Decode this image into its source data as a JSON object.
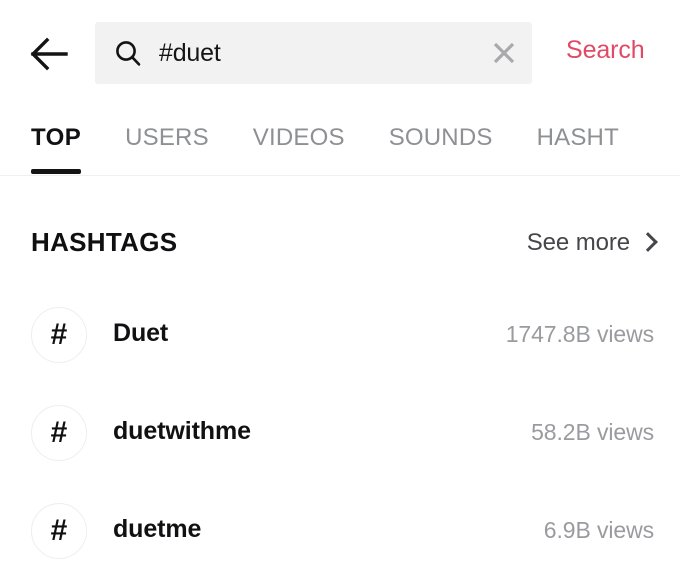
{
  "header": {
    "back_icon": "arrow-left-icon",
    "search": {
      "icon": "search-icon",
      "value": "#duet",
      "placeholder": "Search",
      "clear_icon": "close-icon"
    },
    "search_action_label": "Search",
    "accent_color": "#e04a66"
  },
  "tabs": {
    "active_index": 0,
    "items": [
      {
        "label": "TOP"
      },
      {
        "label": "USERS"
      },
      {
        "label": "VIDEOS"
      },
      {
        "label": "SOUNDS"
      },
      {
        "label": "HASHT"
      }
    ]
  },
  "section": {
    "title": "HASHTAGS",
    "see_more_label": "See more",
    "chevron_icon": "chevron-right-icon"
  },
  "hashtags": [
    {
      "glyph": "#",
      "name": "Duet",
      "views": "1747.8B views"
    },
    {
      "glyph": "#",
      "name": "duetwithme",
      "views": "58.2B views"
    },
    {
      "glyph": "#",
      "name": "duetme",
      "views": "6.9B views"
    }
  ]
}
